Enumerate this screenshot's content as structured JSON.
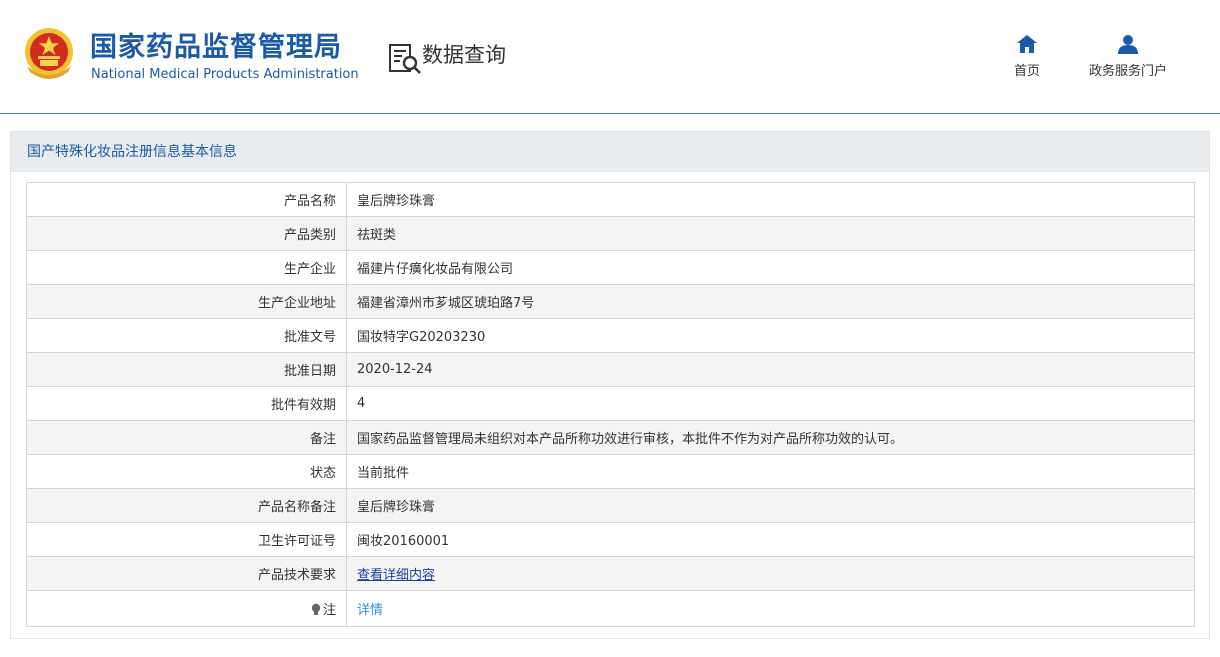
{
  "header": {
    "brand_cn": "国家药品监督管理局",
    "brand_en": "National Medical Products Administration",
    "query_title": "数据查询",
    "nav": {
      "home": "首页",
      "portal": "政务服务门户"
    }
  },
  "panel": {
    "title": "国产特殊化妆品注册信息基本信息",
    "rows": [
      {
        "label": "产品名称",
        "value": "皇后牌珍珠膏"
      },
      {
        "label": "产品类别",
        "value": "祛斑类"
      },
      {
        "label": "生产企业",
        "value": "福建片仔癀化妆品有限公司"
      },
      {
        "label": "生产企业地址",
        "value": "福建省漳州市芗城区琥珀路7号"
      },
      {
        "label": "批准文号",
        "value": "国妆特字G20203230"
      },
      {
        "label": "批准日期",
        "value": "2020-12-24"
      },
      {
        "label": "批件有效期",
        "value": "4"
      },
      {
        "label": "备注",
        "value": "国家药品监督管理局未组织对本产品所称功效进行审核，本批件不作为对产品所称功效的认可。"
      },
      {
        "label": "状态",
        "value": "当前批件"
      },
      {
        "label": "产品名称备注",
        "value": "皇后牌珍珠膏"
      },
      {
        "label": "卫生许可证号",
        "value": "闽妆20160001"
      },
      {
        "label": "产品技术要求",
        "value": "查看详细内容"
      },
      {
        "label": "注",
        "value": "详情"
      }
    ]
  },
  "colors": {
    "brand": "#1a5aa8",
    "panel_head_bg": "#e8ecef",
    "link": "#2e8fd8"
  }
}
